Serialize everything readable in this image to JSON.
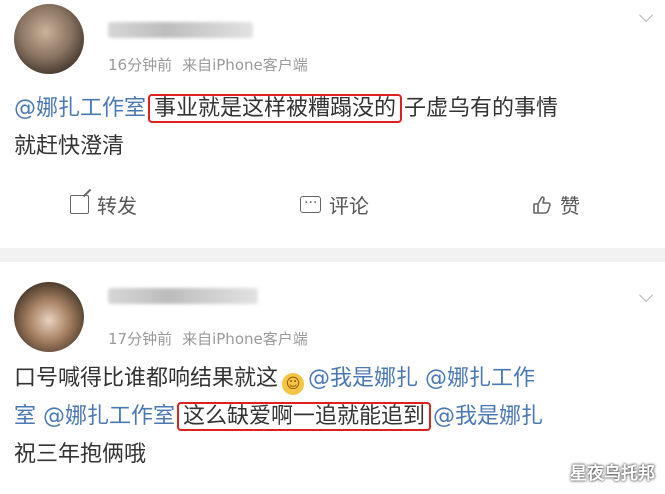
{
  "posts": [
    {
      "time": "16分钟前",
      "source": "来自iPhone客户端",
      "content": {
        "mention": "@娜扎工作室",
        "highlight": "事业就是这样被糟蹋没的",
        "rest": "子虚乌有的事情",
        "line2": "就赶快澄清"
      },
      "actions": {
        "repost": "转发",
        "comment": "评论",
        "like": "赞"
      }
    },
    {
      "time": "17分钟前",
      "source": "来自iPhone客户端",
      "content": {
        "line1_text": "口号喊得比谁都响结果就这",
        "line1_mention1": "@我是娜扎",
        "line1_mention2": "@娜扎工作",
        "line2_mention1": "室",
        "line2_mention2": "@娜扎工作室",
        "highlight": "这么缺爱啊一追就能追到",
        "line2_mention3": "@我是娜扎",
        "line3": "祝三年抱俩哦"
      }
    }
  ],
  "watermark": "星夜乌托邦",
  "colors": {
    "mention": "#4a78b5",
    "highlight_border": "#e0201e",
    "meta": "#9a9a9a"
  }
}
